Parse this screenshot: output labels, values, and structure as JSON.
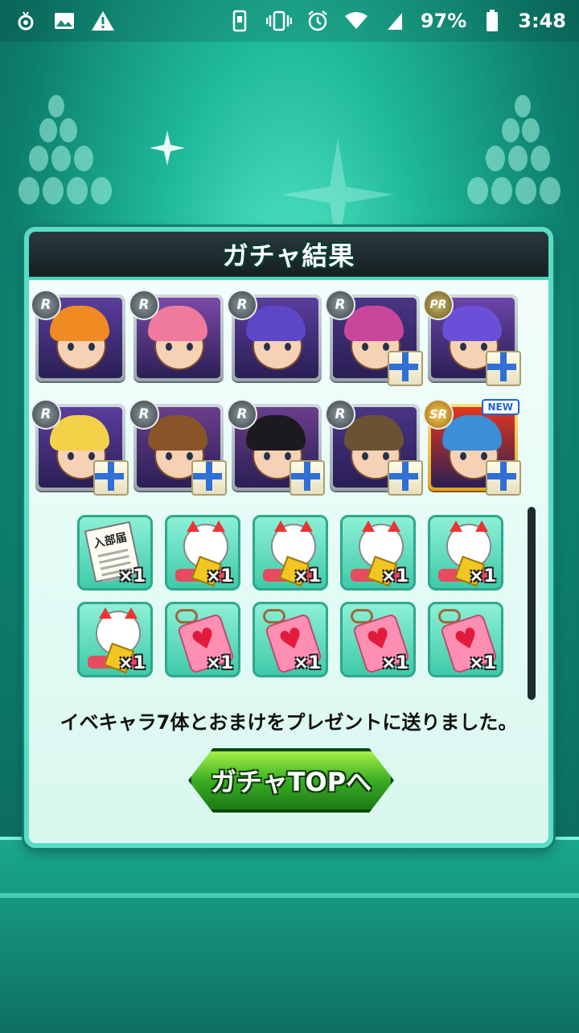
{
  "status_bar": {
    "battery_percent": "97%",
    "time": "3:48",
    "icons_left": [
      "notification-icon",
      "image-icon",
      "warning-icon"
    ],
    "icons_right": [
      "screen-rotate-icon",
      "vibrate-icon",
      "alarm-icon",
      "wifi-icon",
      "signal-icon",
      "battery-icon"
    ]
  },
  "dialog": {
    "title": "ガチャ結果",
    "message": "イベキャラ7体とおまけをプレゼントに送りました。",
    "top_button_label": "ガチャTOPへ"
  },
  "characters": [
    {
      "rarity": "R",
      "hair_color": "#f08a22",
      "bg_color": "#5a3e9c",
      "gift": false,
      "new": false
    },
    {
      "rarity": "R",
      "hair_color": "#f07a9b",
      "bg_color": "#7a4aa8",
      "gift": false,
      "new": false
    },
    {
      "rarity": "R",
      "hair_color": "#5d47c9",
      "bg_color": "#5a3e9c",
      "gift": false,
      "new": false
    },
    {
      "rarity": "R",
      "hair_color": "#c9479b",
      "bg_color": "#4a3585",
      "gift": true,
      "new": false
    },
    {
      "rarity": "PR",
      "hair_color": "#6a4fd8",
      "bg_color": "#6a45a8",
      "gift": true,
      "new": false
    },
    {
      "rarity": "R",
      "hair_color": "#f3d24a",
      "bg_color": "#5a3e9c",
      "gift": true,
      "new": false
    },
    {
      "rarity": "R",
      "hair_color": "#8a5429",
      "bg_color": "#6a3e8c",
      "gift": true,
      "new": false
    },
    {
      "rarity": "R",
      "hair_color": "#1d1a1f",
      "bg_color": "#6a3e8c",
      "gift": true,
      "new": false
    },
    {
      "rarity": "R",
      "hair_color": "#6b5234",
      "bg_color": "#4a3585",
      "gift": true,
      "new": false
    },
    {
      "rarity": "SR",
      "hair_color": "#3a8fd8",
      "bg_color": "#e3371e",
      "gift": true,
      "new": true,
      "new_label": "NEW"
    }
  ],
  "items": [
    {
      "kind": "document",
      "doc_text": "入部届",
      "quantity": "×1"
    },
    {
      "kind": "lucky-cat",
      "quantity": "×1"
    },
    {
      "kind": "lucky-cat",
      "quantity": "×1"
    },
    {
      "kind": "lucky-cat",
      "quantity": "×1"
    },
    {
      "kind": "lucky-cat",
      "quantity": "×1"
    },
    {
      "kind": "lucky-cat",
      "quantity": "×1"
    },
    {
      "kind": "heart-charm",
      "quantity": "×1"
    },
    {
      "kind": "heart-charm",
      "quantity": "×1"
    },
    {
      "kind": "heart-charm",
      "quantity": "×1"
    },
    {
      "kind": "heart-charm",
      "quantity": "×1"
    }
  ]
}
